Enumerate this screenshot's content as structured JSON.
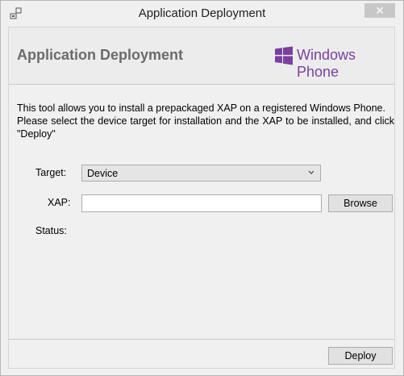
{
  "window": {
    "title": "Application Deployment",
    "close_glyph": "✕"
  },
  "header": {
    "title": "Application Deployment",
    "brand_text": "Windows Phone",
    "brand_color": "#7b3fa0"
  },
  "description": {
    "line1": "This tool allows you to install a prepackaged XAP on a registered Windows Phone.",
    "line2": "Please select the device target for installation and the XAP to be installed, and click \"Deploy\""
  },
  "form": {
    "target_label": "Target:",
    "target_value": "Device",
    "xap_label": "XAP:",
    "xap_value": "",
    "browse_label": "Browse",
    "status_label": "Status:"
  },
  "footer": {
    "deploy_label": "Deploy"
  },
  "icons": {
    "app": "deploy-app-icon",
    "close": "close-icon",
    "logo": "windows-logo-icon",
    "dropdown": "chevron-down-icon"
  }
}
